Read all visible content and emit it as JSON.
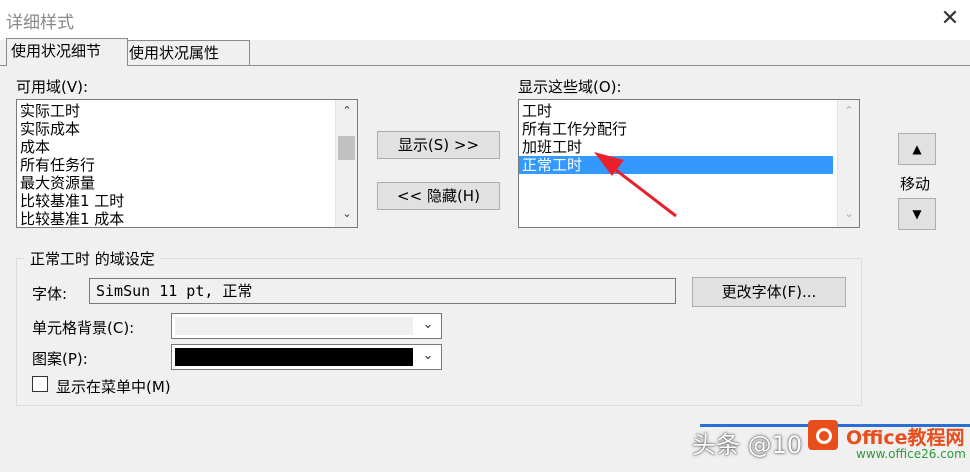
{
  "window": {
    "title": "详细样式",
    "close_glyph": "✕"
  },
  "tabs": [
    {
      "label": "使用状况细节",
      "active": true
    },
    {
      "label": "使用状况属性",
      "active": false
    }
  ],
  "available": {
    "label": "可用域(V):",
    "items": [
      "实际工时",
      "实际成本",
      "成本",
      "所有任务行",
      "最大资源量",
      "比较基准1 工时",
      "比较基准1 成本"
    ]
  },
  "shown": {
    "label": "显示这些域(O):",
    "items": [
      "工时",
      "所有工作分配行",
      "加班工时",
      "正常工时"
    ],
    "selected_index": 3
  },
  "buttons": {
    "show": "显示(S) >>",
    "hide": "<< 隐藏(H)",
    "change_font": "更改字体(F)..."
  },
  "move": {
    "label": "移动",
    "up_glyph": "▲",
    "down_glyph": "▼"
  },
  "settings": {
    "title": "正常工时 的域设定",
    "font_label": "字体:",
    "font_value": "SimSun 11 pt, 正常",
    "cell_bg_label": "单元格背景(C):",
    "pattern_label": "图案(P):",
    "pattern_color": "#000000",
    "cell_bg_color": "#f0f0f0",
    "show_in_menu_label": "显示在菜单中(M)",
    "show_in_menu_checked": false
  },
  "watermark": {
    "text": "头条 @10",
    "site": "Office教程网",
    "url": "www.office26.com"
  },
  "colors": {
    "selection": "#3399ff",
    "annotation_arrow": "#e8202a"
  }
}
